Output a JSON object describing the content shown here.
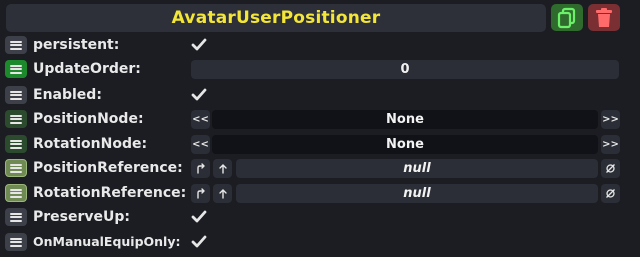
{
  "component": {
    "title": "AvatarUserPositioner",
    "duplicate_icon": "duplicate-icon",
    "delete_icon": "trash-icon",
    "colors": {
      "title": "#f4e636",
      "duplicate_bg": "#2f6b2c",
      "delete_bg": "#7a2f33"
    }
  },
  "fields": {
    "persistent": {
      "label": "persistent:",
      "checked": true
    },
    "update_order": {
      "label": "UpdateOrder:",
      "value": "0"
    },
    "enabled": {
      "label": "Enabled:",
      "checked": true
    },
    "position_node": {
      "label": "PositionNode:",
      "value": "None",
      "prev": "<<",
      "next": ">>"
    },
    "rotation_node": {
      "label": "RotationNode:",
      "value": "None",
      "prev": "<<",
      "next": ">>"
    },
    "position_reference": {
      "label": "PositionReference:",
      "value": "null"
    },
    "rotation_reference": {
      "label": "RotationReference:",
      "value": "null"
    },
    "preserve_up": {
      "label": "PreserveUp:",
      "checked": true
    },
    "on_manual_equip_only": {
      "label": "OnManualEquipOnly:",
      "checked": true
    }
  },
  "icons": {
    "drag_handle": "drag-handle-icon",
    "checkmark": "checkmark-icon",
    "jump_to": "jump-to-icon",
    "upload": "arrow-up-icon",
    "clear": "clear-null-icon"
  }
}
